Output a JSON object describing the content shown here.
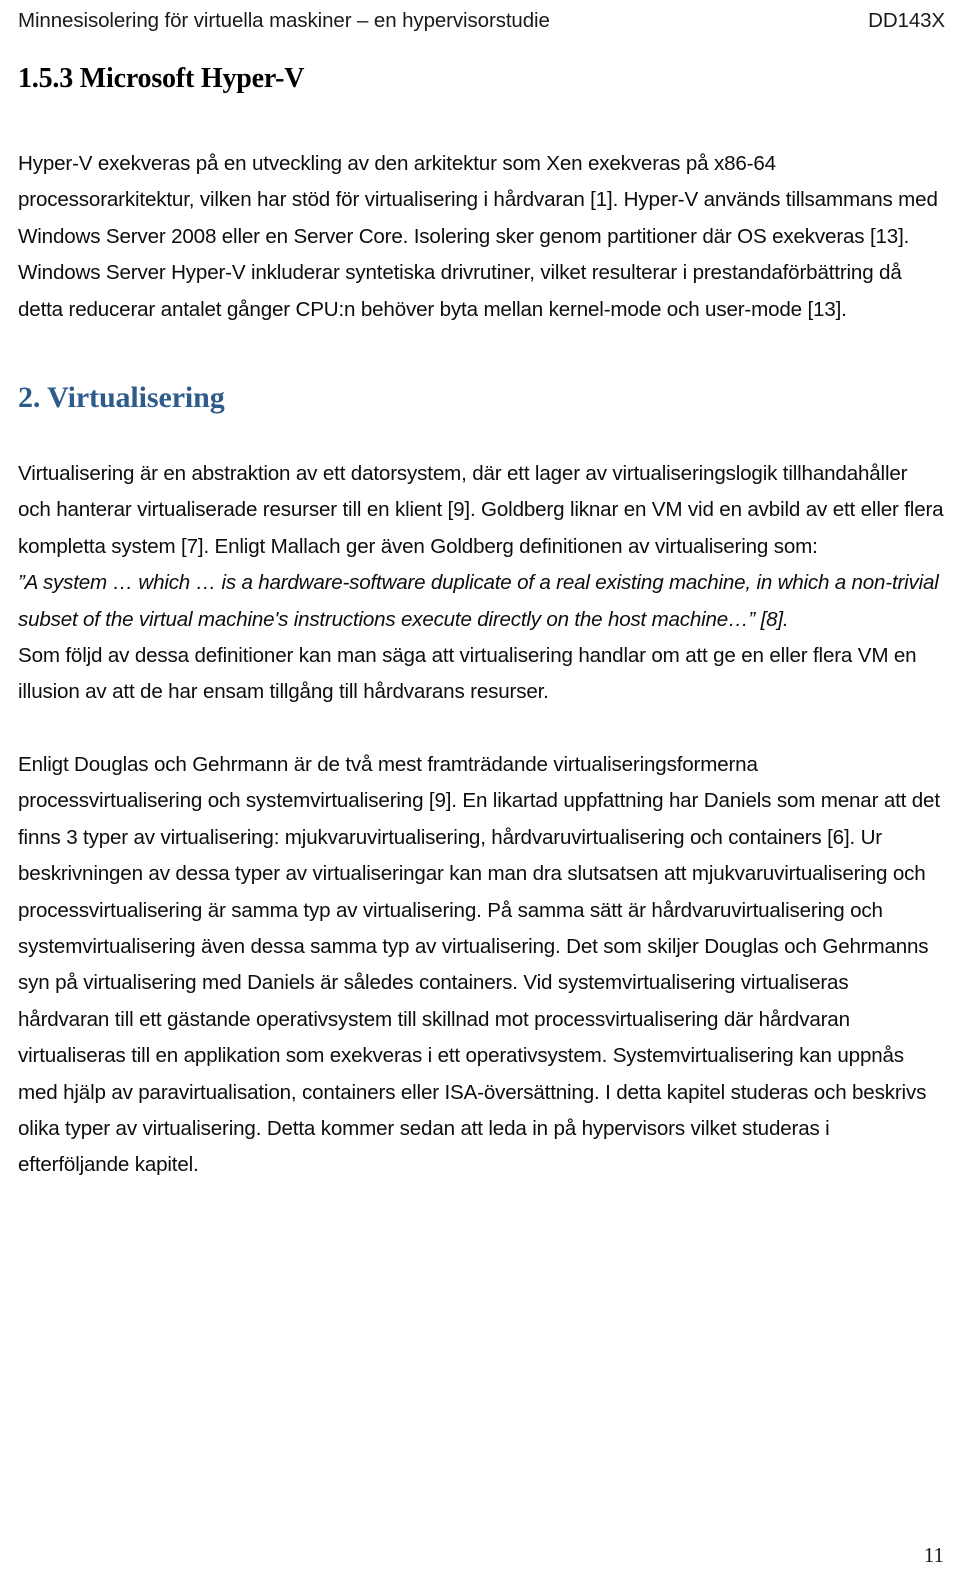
{
  "header": {
    "title_left": "Minnesisolering för virtuella maskiner – en hypervisorstudie",
    "course_code_right": "DD143X"
  },
  "document": {
    "section_1_5_3": {
      "heading": "1.5.3 Microsoft Hyper-V",
      "paragraph": "Hyper-V exekveras på en utveckling av den arkitektur som Xen exekveras på x86-64 processorarkitektur, vilken har stöd för virtualisering i hårdvaran [1]. Hyper-V används tillsammans med Windows Server 2008 eller en Server Core. Isolering sker genom partitioner där OS exekveras [13]. Windows Server Hyper-V inkluderar syntetiska drivrutiner, vilket resulterar i prestandaförbättring då detta reducerar antalet gånger CPU:n behöver byta mellan kernel-mode och user-mode [13]."
    },
    "section_2": {
      "heading": "2. Virtualisering",
      "paragraph_1": "Virtualisering är en abstraktion av ett datorsystem, där ett lager av virtualiseringslogik tillhandahåller och hanterar virtualiserade resurser till en klient [9]. Goldberg liknar en VM vid en avbild av ett eller flera kompletta system [7]. Enligt Mallach ger även Goldberg definitionen av virtualisering som:",
      "quote": "”A system … which … is a hardware-software duplicate of a real existing machine, in which a non-trivial subset of the virtual machine's instructions execute directly on the host machine…” [8].",
      "paragraph_2": "Som följd av dessa definitioner kan man säga att virtualisering handlar om att ge en eller flera VM en illusion av att de har ensam tillgång till hårdvarans resurser.",
      "paragraph_3": "Enligt Douglas och Gehrmann är de två mest framträdande virtualiseringsformerna processvirtualisering och systemvirtualisering [9]. En likartad uppfattning har Daniels som menar att det finns 3 typer av virtualisering: mjukvaruvirtualisering, hårdvaruvirtualisering och containers [6]. Ur beskrivningen av dessa typer av virtualiseringar kan man dra slutsatsen att mjukvaruvirtualisering och processvirtualisering är samma typ av virtualisering. På samma sätt är hårdvaruvirtualisering och systemvirtualisering även dessa samma typ av virtualisering. Det som skiljer Douglas och Gehrmanns syn på virtualisering med Daniels är således containers. Vid systemvirtualisering virtualiseras hårdvaran till ett gästande operativsystem till skillnad mot processvirtualisering där hårdvaran virtualiseras till en applikation som exekveras i ett operativsystem. Systemvirtualisering kan uppnås med hjälp av paravirtualisation, containers eller ISA-översättning. I detta kapitel studeras och beskrivs olika typer av virtualisering. Detta kommer sedan att leda in på hypervisors vilket studeras i efterföljande kapitel."
    }
  },
  "footer": {
    "page_number": "11"
  },
  "colors": {
    "chapter_heading": "#2f5b8b",
    "body_text": "#0d0d0d",
    "page_background": "#ffffff"
  }
}
